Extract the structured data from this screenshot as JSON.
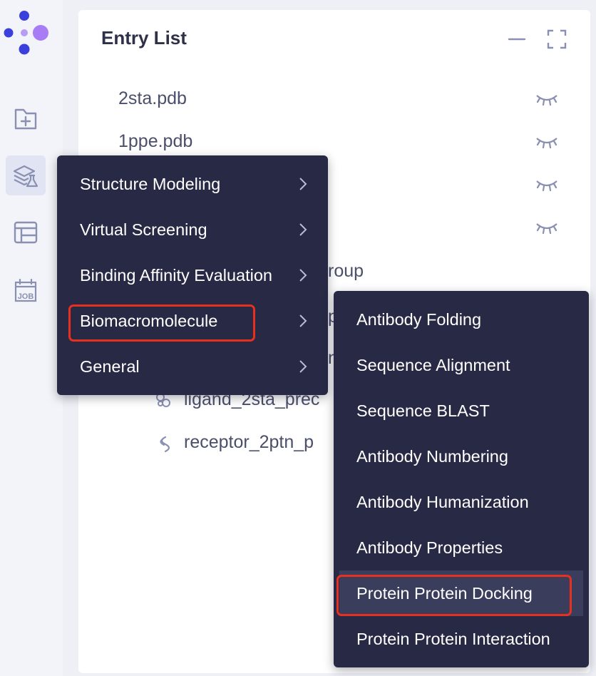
{
  "logo": {
    "icon": "app-logo-dots"
  },
  "rail": {
    "items": [
      {
        "icon": "new-folder-icon",
        "active": false
      },
      {
        "icon": "layers-flask-icon",
        "active": true
      },
      {
        "icon": "table-layout-icon",
        "active": false
      },
      {
        "icon": "job-icon",
        "active": false,
        "label": "JOB"
      }
    ]
  },
  "panel": {
    "title": "Entry List",
    "entries": [
      {
        "label": "2sta.pdb",
        "visible": false
      },
      {
        "label": "1ppe.pdb",
        "visible": false
      },
      {
        "label": "",
        "visible": false
      },
      {
        "label": "",
        "visible": false
      }
    ],
    "partial_entries": {
      "group_suffix": "roup",
      "row6_suffix": "pc",
      "row7_suffix": "n",
      "ligand": "ligand_2sta_prec",
      "receptor": "receptor_2ptn_p"
    }
  },
  "main_menu": {
    "items": [
      {
        "label": "Structure Modeling"
      },
      {
        "label": "Virtual Screening"
      },
      {
        "label": "Binding Affinity Evaluation"
      },
      {
        "label": "Biomacromolecule",
        "highlighted": true
      },
      {
        "label": "General"
      }
    ]
  },
  "sub_menu": {
    "items": [
      {
        "label": "Antibody Folding"
      },
      {
        "label": "Sequence Alignment"
      },
      {
        "label": "Sequence BLAST"
      },
      {
        "label": "Antibody Numbering"
      },
      {
        "label": "Antibody Humanization"
      },
      {
        "label": "Antibody Properties"
      },
      {
        "label": "Protein Protein Docking",
        "highlighted": true
      },
      {
        "label": "Protein Protein Interaction"
      }
    ]
  },
  "colors": {
    "menu_bg": "#272945",
    "menu_hover": "#3a3d5c",
    "highlight_red": "#e8301f",
    "logo_blue": "#3b3fdc",
    "logo_purple": "#a77cf5",
    "icon_gray": "#8a90b2"
  }
}
